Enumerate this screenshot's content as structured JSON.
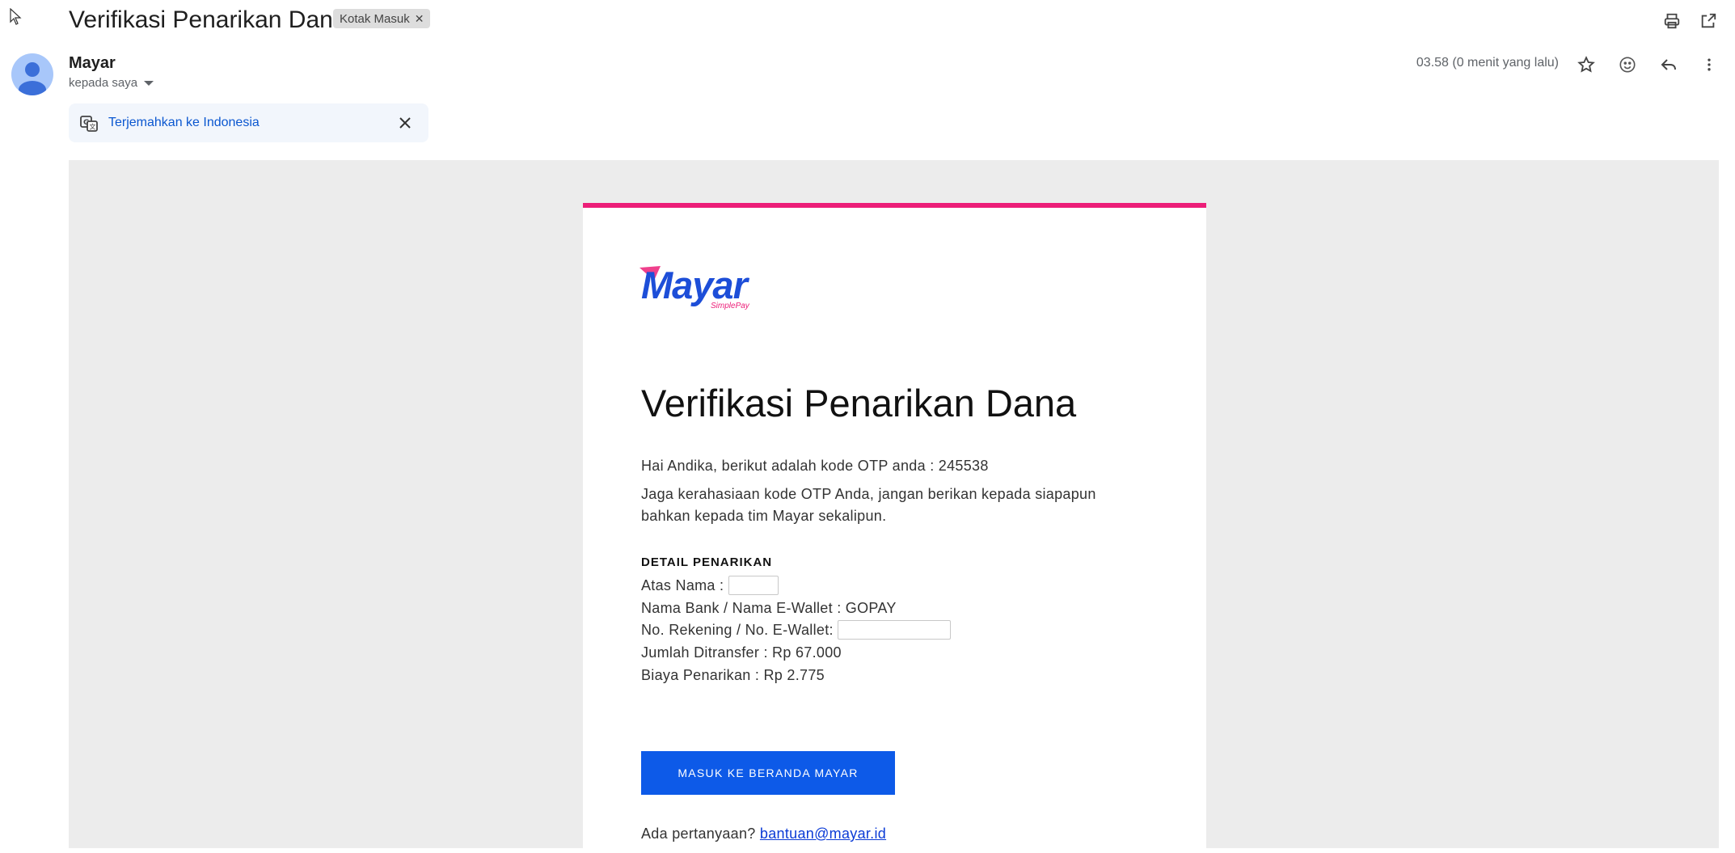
{
  "email": {
    "subject": "Verifikasi Penarikan Dana",
    "label_chip": "Kotak Masuk",
    "sender": "Mayar",
    "recipient": "kepada saya",
    "time": "03.58 (0 menit yang lalu)"
  },
  "translate": {
    "text": "Terjemahkan ke Indonesia"
  },
  "body": {
    "logo_text": "Mayar",
    "logo_sub": "SimplePay",
    "title": "Verifikasi Penarikan Dana",
    "greeting": "Hai Andika, berikut adalah kode OTP anda : 245538",
    "warning_line1": "Jaga kerahasiaan kode OTP Anda, jangan berikan kepada siapapun",
    "warning_line2": "bahkan kepada tim Mayar sekalipun.",
    "detail_heading": "DETAIL PENARIKAN",
    "detail_name_label": "Atas Nama :",
    "detail_bank": "Nama Bank / Nama E-Wallet : GOPAY",
    "detail_account_label": "No. Rekening / No. E-Wallet:",
    "detail_amount": "Jumlah Ditransfer : Rp 67.000",
    "detail_fee": "Biaya Penarikan : Rp 2.775",
    "cta_label": "MASUK KE BERANDA MAYAR",
    "question_text": "Ada pertanyaan?",
    "support_email": "bantuan@mayar.id"
  },
  "colors": {
    "accent_pink": "#ec1e78",
    "cta_blue": "#0d5ae8",
    "link_blue": "#0b57d0"
  }
}
